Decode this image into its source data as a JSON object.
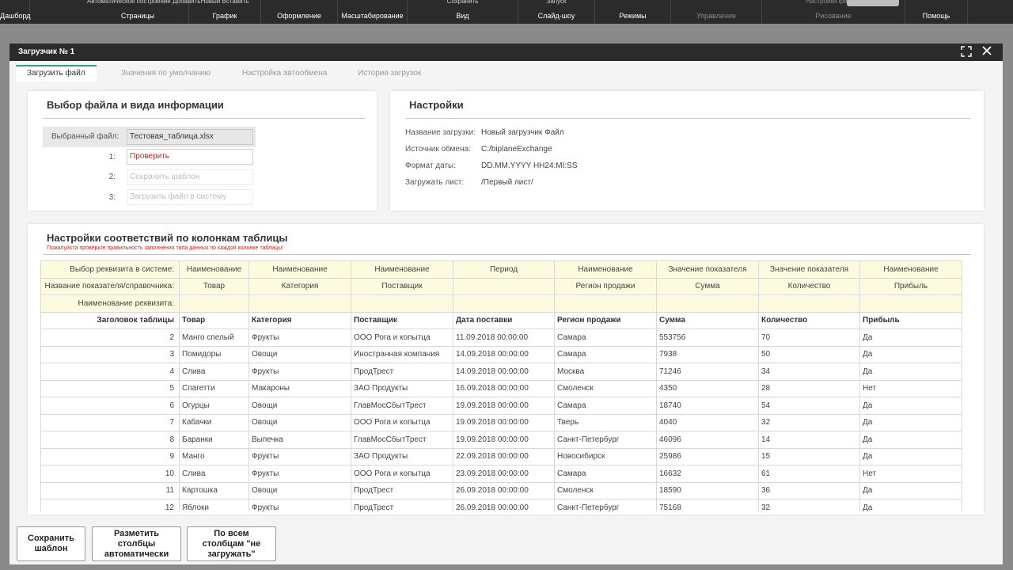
{
  "ribbon": {
    "groups": [
      {
        "label": "Дашборд",
        "top": ""
      },
      {
        "label": "Страницы",
        "top": "Автоматическое построение  Добавить"
      },
      {
        "label": "График",
        "top": "Новый  Вставить"
      },
      {
        "label": "Оформление",
        "top": ""
      },
      {
        "label": "Масштабирование",
        "top": ""
      },
      {
        "label": "Вид",
        "top": "Сохранить"
      },
      {
        "label": "Слайд-шоу",
        "top": "Запуск"
      },
      {
        "label": "Режимы",
        "top": ""
      },
      {
        "label": "Управление",
        "top": ""
      },
      {
        "label": "Рисование",
        "top": "Настройки фигуры"
      },
      {
        "label": "Помощь",
        "top": ""
      }
    ]
  },
  "modal": {
    "title": "Загрузчик № 1",
    "tabs": [
      "Загрузить файл",
      "Значения по умолчанию",
      "Настройка автообмена",
      "История загрузок"
    ]
  },
  "file_panel": {
    "title": "Выбор файла и вида информации",
    "selected_label": "Выбранный файл:",
    "selected_value": "Тестовая_таблица.xlsx",
    "steps": [
      {
        "num": "1:",
        "text": "Проверить"
      },
      {
        "num": "2:",
        "text": "Сохранить шаблон"
      },
      {
        "num": "3:",
        "text": "Загрузить файл в систему"
      }
    ]
  },
  "settings_panel": {
    "title": "Настройки",
    "rows": [
      {
        "key": "Название загрузки:",
        "value": "Новый загрузчик Файл"
      },
      {
        "key": "Источник обмена:",
        "value": "C:/biplaneExchange"
      },
      {
        "key": "Формат даты:",
        "value": "DD.MM.YYYY HH24:MI:SS"
      },
      {
        "key": "Загружать лист:",
        "value": "/Первый лист/"
      }
    ]
  },
  "mapping": {
    "title": "Настройки соответствий по колонкам таблицы",
    "warning": "Пожалуйста проверьте правильность заполнения типа данных по каждой колонке таблицы!",
    "row_labels": {
      "attr": "Выбор реквизита в системе:",
      "indicator": "Название показателя/справочника:",
      "attr_name": "Наименование реквизита:",
      "header": "Заголовок таблицы"
    },
    "attr": [
      "Наименование",
      "Наименование",
      "Наименование",
      "Период",
      "Наименование",
      "Значение показателя",
      "Значение показателя",
      "Наименование"
    ],
    "indicator": [
      "Товар",
      "Категория",
      "Поставщик",
      "",
      "Регион продажи",
      "Сумма",
      "Количество",
      "Прибыль"
    ],
    "attr_name": [
      "",
      "",
      "",
      "",
      "",
      "",
      "",
      ""
    ],
    "headers": [
      "Товар",
      "Категория",
      "Поставщик",
      "Дата поставки",
      "Регион продажи",
      "Сумма",
      "Количество",
      "Прибыль"
    ],
    "rows": [
      [
        "2",
        "Манго спелый",
        "Фрукты",
        "ООО Рога и копытца",
        "11.09.2018 00:00:00",
        "Самара",
        "553756",
        "70",
        "Да"
      ],
      [
        "3",
        "Помидоры",
        "Овощи",
        "Иностранная компания",
        "14.09.2018 00:00:00",
        "Самара",
        "7938",
        "50",
        "Да"
      ],
      [
        "4",
        "Слива",
        "Фрукты",
        "ПродТрест",
        "14.09.2018 00:00:00",
        "Москва",
        "71246",
        "34",
        "Да"
      ],
      [
        "5",
        "Спагетти",
        "Макароны",
        "ЗАО Продукты",
        "16.09.2018 00:00:00",
        "Смоленск",
        "4350",
        "28",
        "Нет"
      ],
      [
        "6",
        "Огурцы",
        "Овощи",
        "ГлавМосСбытТрест",
        "19.09.2018 00:00:00",
        "Самара",
        "18740",
        "54",
        "Да"
      ],
      [
        "7",
        "Кабачки",
        "Овощи",
        "ООО Рога и копытца",
        "19.09.2018 00:00:00",
        "Тверь",
        "4040",
        "32",
        "Да"
      ],
      [
        "8",
        "Баранки",
        "Выпечка",
        "ГлавМосСбытТрест",
        "19.09.2018 00:00:00",
        "Санкт-Петербург",
        "46096",
        "14",
        "Да"
      ],
      [
        "9",
        "Манго",
        "Фрукты",
        "ЗАО Продукты",
        "22.09.2018 00:00:00",
        "Новосибирск",
        "25986",
        "15",
        "Да"
      ],
      [
        "10",
        "Слива",
        "Фрукты",
        "ООО Рога и копытца",
        "23.09.2018 00:00:00",
        "Самара",
        "16632",
        "61",
        "Нет"
      ],
      [
        "11",
        "Картошка",
        "Овощи",
        "ПродТрест",
        "26.09.2018 00:00:00",
        "Смоленск",
        "18590",
        "36",
        "Да"
      ],
      [
        "12",
        "Яблоки",
        "Фрукты",
        "ПродТрест",
        "26.09.2018 00:00:00",
        "Санкт-Петербург",
        "75168",
        "32",
        "Да"
      ]
    ]
  },
  "buttons": {
    "save_template": "Сохранить\nшаблон",
    "auto_mark": "Разметить\nстолбцы\nавтоматически",
    "skip_all": "По всем\nстолбцам \"не\nзагружать\""
  },
  "colors": {
    "accent_tab": "#2ea866",
    "config_rows": "#fdfbdf",
    "error_text": "#d32020"
  }
}
